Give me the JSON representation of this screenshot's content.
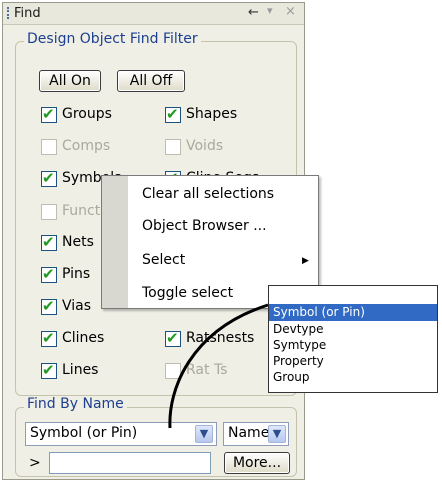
{
  "window": {
    "title": "Find",
    "pin_icon": "pin-icon",
    "dropdown_icon": "chevron-down-icon",
    "close_icon": "close-icon"
  },
  "filter": {
    "group_title": "Design Object Find Filter",
    "all_on": "All On",
    "all_off": "All Off",
    "items": [
      {
        "label": "Groups",
        "checked": true,
        "enabled": true
      },
      {
        "label": "Shapes",
        "checked": true,
        "enabled": true
      },
      {
        "label": "Comps",
        "checked": false,
        "enabled": false
      },
      {
        "label": "Voids",
        "checked": false,
        "enabled": false
      },
      {
        "label": "Symbols",
        "checked": true,
        "enabled": true
      },
      {
        "label": "Cline Segs",
        "checked": true,
        "enabled": true
      },
      {
        "label": "Functions",
        "checked": false,
        "enabled": false
      },
      {
        "label": "Nets",
        "checked": true,
        "enabled": true
      },
      {
        "label": "Pins",
        "checked": true,
        "enabled": true
      },
      {
        "label": "Vias",
        "checked": true,
        "enabled": true
      },
      {
        "label": "Clines",
        "checked": true,
        "enabled": true
      },
      {
        "label": "Ratsnests",
        "checked": true,
        "enabled": true
      },
      {
        "label": "Lines",
        "checked": true,
        "enabled": true
      },
      {
        "label": "Rat Ts",
        "checked": false,
        "enabled": false
      }
    ]
  },
  "find_by_name": {
    "group_title": "Find By Name",
    "type_value": "Symbol (or Pin)",
    "mode_value": "Name",
    "prompt": ">",
    "text_value": "",
    "more_button": "More..."
  },
  "context_menu": {
    "items": [
      {
        "label": "Clear all selections",
        "submenu": false
      },
      {
        "label": "Object Browser ...",
        "submenu": false
      },
      {
        "label": "Select",
        "submenu": true
      },
      {
        "label": "Toggle select",
        "submenu": true
      }
    ]
  },
  "type_list": {
    "options": [
      "Symbol (or Pin)",
      "Devtype",
      "Symtype",
      "Property",
      "Group"
    ],
    "selected_index": 0
  }
}
